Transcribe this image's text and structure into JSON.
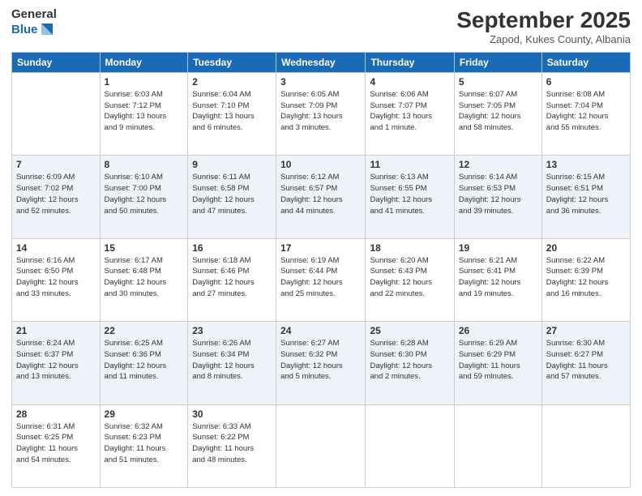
{
  "header": {
    "logo_general": "General",
    "logo_blue": "Blue",
    "month_title": "September 2025",
    "location": "Zapod, Kukes County, Albania"
  },
  "days_of_week": [
    "Sunday",
    "Monday",
    "Tuesday",
    "Wednesday",
    "Thursday",
    "Friday",
    "Saturday"
  ],
  "weeks": [
    [
      {
        "day": "",
        "info": ""
      },
      {
        "day": "1",
        "info": "Sunrise: 6:03 AM\nSunset: 7:12 PM\nDaylight: 13 hours\nand 9 minutes."
      },
      {
        "day": "2",
        "info": "Sunrise: 6:04 AM\nSunset: 7:10 PM\nDaylight: 13 hours\nand 6 minutes."
      },
      {
        "day": "3",
        "info": "Sunrise: 6:05 AM\nSunset: 7:09 PM\nDaylight: 13 hours\nand 3 minutes."
      },
      {
        "day": "4",
        "info": "Sunrise: 6:06 AM\nSunset: 7:07 PM\nDaylight: 13 hours\nand 1 minute."
      },
      {
        "day": "5",
        "info": "Sunrise: 6:07 AM\nSunset: 7:05 PM\nDaylight: 12 hours\nand 58 minutes."
      },
      {
        "day": "6",
        "info": "Sunrise: 6:08 AM\nSunset: 7:04 PM\nDaylight: 12 hours\nand 55 minutes."
      }
    ],
    [
      {
        "day": "7",
        "info": "Sunrise: 6:09 AM\nSunset: 7:02 PM\nDaylight: 12 hours\nand 52 minutes."
      },
      {
        "day": "8",
        "info": "Sunrise: 6:10 AM\nSunset: 7:00 PM\nDaylight: 12 hours\nand 50 minutes."
      },
      {
        "day": "9",
        "info": "Sunrise: 6:11 AM\nSunset: 6:58 PM\nDaylight: 12 hours\nand 47 minutes."
      },
      {
        "day": "10",
        "info": "Sunrise: 6:12 AM\nSunset: 6:57 PM\nDaylight: 12 hours\nand 44 minutes."
      },
      {
        "day": "11",
        "info": "Sunrise: 6:13 AM\nSunset: 6:55 PM\nDaylight: 12 hours\nand 41 minutes."
      },
      {
        "day": "12",
        "info": "Sunrise: 6:14 AM\nSunset: 6:53 PM\nDaylight: 12 hours\nand 39 minutes."
      },
      {
        "day": "13",
        "info": "Sunrise: 6:15 AM\nSunset: 6:51 PM\nDaylight: 12 hours\nand 36 minutes."
      }
    ],
    [
      {
        "day": "14",
        "info": "Sunrise: 6:16 AM\nSunset: 6:50 PM\nDaylight: 12 hours\nand 33 minutes."
      },
      {
        "day": "15",
        "info": "Sunrise: 6:17 AM\nSunset: 6:48 PM\nDaylight: 12 hours\nand 30 minutes."
      },
      {
        "day": "16",
        "info": "Sunrise: 6:18 AM\nSunset: 6:46 PM\nDaylight: 12 hours\nand 27 minutes."
      },
      {
        "day": "17",
        "info": "Sunrise: 6:19 AM\nSunset: 6:44 PM\nDaylight: 12 hours\nand 25 minutes."
      },
      {
        "day": "18",
        "info": "Sunrise: 6:20 AM\nSunset: 6:43 PM\nDaylight: 12 hours\nand 22 minutes."
      },
      {
        "day": "19",
        "info": "Sunrise: 6:21 AM\nSunset: 6:41 PM\nDaylight: 12 hours\nand 19 minutes."
      },
      {
        "day": "20",
        "info": "Sunrise: 6:22 AM\nSunset: 6:39 PM\nDaylight: 12 hours\nand 16 minutes."
      }
    ],
    [
      {
        "day": "21",
        "info": "Sunrise: 6:24 AM\nSunset: 6:37 PM\nDaylight: 12 hours\nand 13 minutes."
      },
      {
        "day": "22",
        "info": "Sunrise: 6:25 AM\nSunset: 6:36 PM\nDaylight: 12 hours\nand 11 minutes."
      },
      {
        "day": "23",
        "info": "Sunrise: 6:26 AM\nSunset: 6:34 PM\nDaylight: 12 hours\nand 8 minutes."
      },
      {
        "day": "24",
        "info": "Sunrise: 6:27 AM\nSunset: 6:32 PM\nDaylight: 12 hours\nand 5 minutes."
      },
      {
        "day": "25",
        "info": "Sunrise: 6:28 AM\nSunset: 6:30 PM\nDaylight: 12 hours\nand 2 minutes."
      },
      {
        "day": "26",
        "info": "Sunrise: 6:29 AM\nSunset: 6:29 PM\nDaylight: 11 hours\nand 59 minutes."
      },
      {
        "day": "27",
        "info": "Sunrise: 6:30 AM\nSunset: 6:27 PM\nDaylight: 11 hours\nand 57 minutes."
      }
    ],
    [
      {
        "day": "28",
        "info": "Sunrise: 6:31 AM\nSunset: 6:25 PM\nDaylight: 11 hours\nand 54 minutes."
      },
      {
        "day": "29",
        "info": "Sunrise: 6:32 AM\nSunset: 6:23 PM\nDaylight: 11 hours\nand 51 minutes."
      },
      {
        "day": "30",
        "info": "Sunrise: 6:33 AM\nSunset: 6:22 PM\nDaylight: 11 hours\nand 48 minutes."
      },
      {
        "day": "",
        "info": ""
      },
      {
        "day": "",
        "info": ""
      },
      {
        "day": "",
        "info": ""
      },
      {
        "day": "",
        "info": ""
      }
    ]
  ]
}
